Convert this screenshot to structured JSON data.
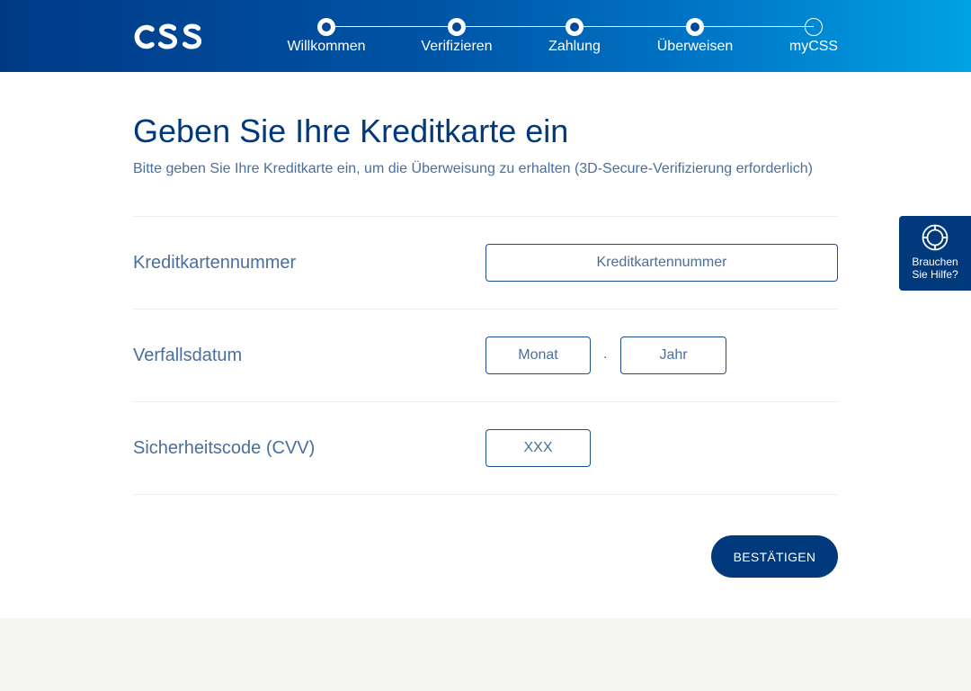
{
  "brand": {
    "logo_text": "CSS"
  },
  "progress": {
    "steps": [
      {
        "label": "Willkommen",
        "state": "completed"
      },
      {
        "label": "Verifizieren",
        "state": "completed"
      },
      {
        "label": "Zahlung",
        "state": "completed"
      },
      {
        "label": "Überweisen",
        "state": "current"
      },
      {
        "label": "myCSS",
        "state": "pending"
      }
    ]
  },
  "main": {
    "title": "Geben Sie Ihre Kreditkarte ein",
    "subtitle": "Bitte geben Sie Ihre Kreditkarte ein, um die Überweisung zu erhalten (3D-Secure-Verifizierung erforderlich)"
  },
  "form": {
    "card_number": {
      "label": "Kreditkartennummer",
      "placeholder": "Kreditkartennummer",
      "value": ""
    },
    "expiry": {
      "label": "Verfallsdatum",
      "month_placeholder": "Monat",
      "separator": ".",
      "year_placeholder": "Jahr"
    },
    "cvv": {
      "label": "Sicherheitscode (CVV)",
      "placeholder": "XXX",
      "value": ""
    },
    "submit_label": "BESTÄTIGEN"
  },
  "help": {
    "line1": "Brauchen",
    "line2": "Sie Hilfe?",
    "icon": "lifebuoy-icon"
  },
  "colors": {
    "primary": "#003a7d",
    "text_muted": "#4a6f9b",
    "header_gradient_start": "#003a86",
    "header_gradient_end": "#00a3e2",
    "footer_bg": "#f5f5f2"
  }
}
